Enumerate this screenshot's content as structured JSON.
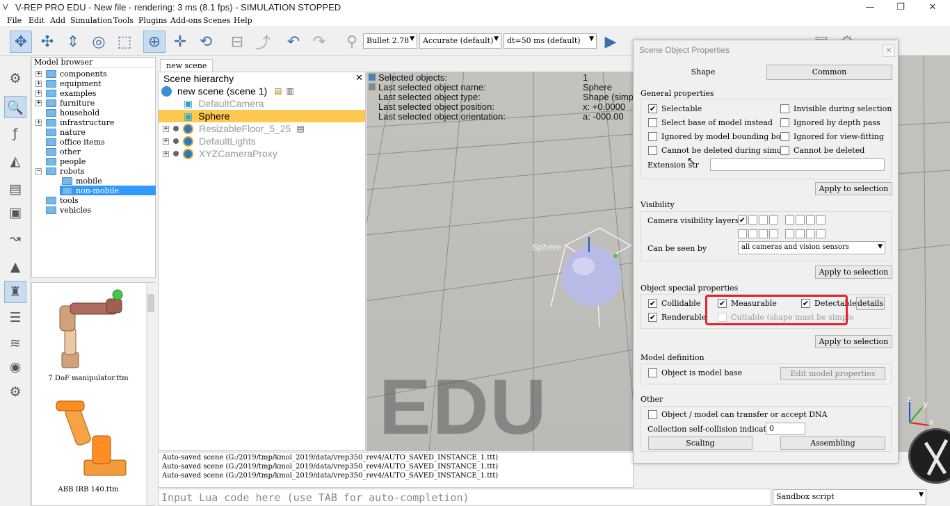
{
  "window": {
    "title": "V-REP PRO EDU - New file - rendering: 3 ms (8.1 fps) - SIMULATION STOPPED",
    "minimize": "—",
    "restore": "❐",
    "close": "✕"
  },
  "menu": [
    "File",
    "Edit",
    "Add",
    "Simulation",
    "Tools",
    "Plugins",
    "Add-ons",
    "Scenes",
    "Help"
  ],
  "toolbar": {
    "engine": "Bullet 2.78",
    "accuracy": "Accurate (default)",
    "timestep": "dt=50 ms (default)"
  },
  "model_browser": {
    "header": "Model browser",
    "items": [
      "components",
      "equipment",
      "examples",
      "furniture",
      "household",
      "infrastructure",
      "nature",
      "office items",
      "other",
      "people",
      "robots",
      "mobile",
      "non-mobile",
      "tools",
      "vehicles"
    ],
    "thumbnails": [
      "7 DoF manipulator.ttm",
      "ABB IRB 140.ttm"
    ]
  },
  "scene": {
    "tab": "new scene",
    "hierarchy_title": "Scene hierarchy",
    "root": "new scene (scene 1)",
    "objects": [
      "DefaultCamera",
      "Sphere",
      "ResizableFloor_5_25",
      "DefaultLights",
      "XYZCameraProxy"
    ]
  },
  "viewport": {
    "info_labels": [
      "Selected objects:",
      "Last selected object name:",
      "Last selected object type:",
      "Last selected object position:",
      "Last selected object orientation:"
    ],
    "info_values": [
      "1",
      "Sphere",
      "Shape (simp",
      "x: +0.0000",
      "a: -000.00"
    ],
    "object_label": "Sphere",
    "watermark": "EDU",
    "axis_z": "z",
    "axis_y": "y",
    "axis_x": "x"
  },
  "console": {
    "lines": [
      "Auto-saved scene (G:/2019/tmp/kmol_2019/data/vrep350_rev4/AUTO_SAVED_INSTANCE_1.ttt)",
      "Auto-saved scene (G:/2019/tmp/kmol_2019/data/vrep350_rev4/AUTO_SAVED_INSTANCE_1.ttt)",
      "Auto-saved scene (G:/2019/tmp/kmol_2019/data/vrep350_rev4/AUTO_SAVED_INSTANCE_1.ttt)"
    ],
    "lua_placeholder": "Input Lua code here (use TAB for auto-completion)",
    "script_type": "Sandbox script"
  },
  "dialog": {
    "title": "Scene Object Properties",
    "close": "✕",
    "tab_shape": "Shape",
    "tab_common": "Common",
    "general": {
      "title": "General properties",
      "selectable": {
        "label": "Selectable",
        "mark": "✔"
      },
      "select_base": "Select base of model instead",
      "ignored_bbox": "Ignored by model bounding  box",
      "cannot_delete_sim": "Cannot be deleted during simul.",
      "invisible": "Invisible during selection",
      "ignored_depth": "Ignored by depth pass",
      "ignored_view": "Ignored for view-fitting",
      "cannot_delete": "Cannot be deleted",
      "extension_label": "Extension str",
      "extension_value": "",
      "apply": "Apply to selection"
    },
    "visibility": {
      "title": "Visibility",
      "layers_label": "Camera visibility layers",
      "layer_mark": "✔",
      "seen_by_label": "Can be seen by",
      "seen_by_value": "all cameras and vision sensors",
      "apply": "Apply to selection"
    },
    "special": {
      "title": "Object special properties",
      "collidable": {
        "label": "Collidable",
        "mark": "✔"
      },
      "measurable": {
        "label": "Measurable",
        "mark": "✔"
      },
      "detectable": {
        "label": "Detectable",
        "mark": "✔"
      },
      "renderable": {
        "label": "Renderable",
        "mark": "✔"
      },
      "cuttable": "Cuttable (shape must be simple & non-pure",
      "details": "details",
      "apply": "Apply to selection"
    },
    "model": {
      "title": "Model definition",
      "is_model_base": "Object is model base",
      "edit": "Edit model properties"
    },
    "other": {
      "title": "Other",
      "dna": "Object / model can transfer or accept DNA",
      "collision_label": "Collection self-collision indicator",
      "collision_value": "0",
      "scaling": "Scaling",
      "assembling": "Assembling"
    }
  }
}
